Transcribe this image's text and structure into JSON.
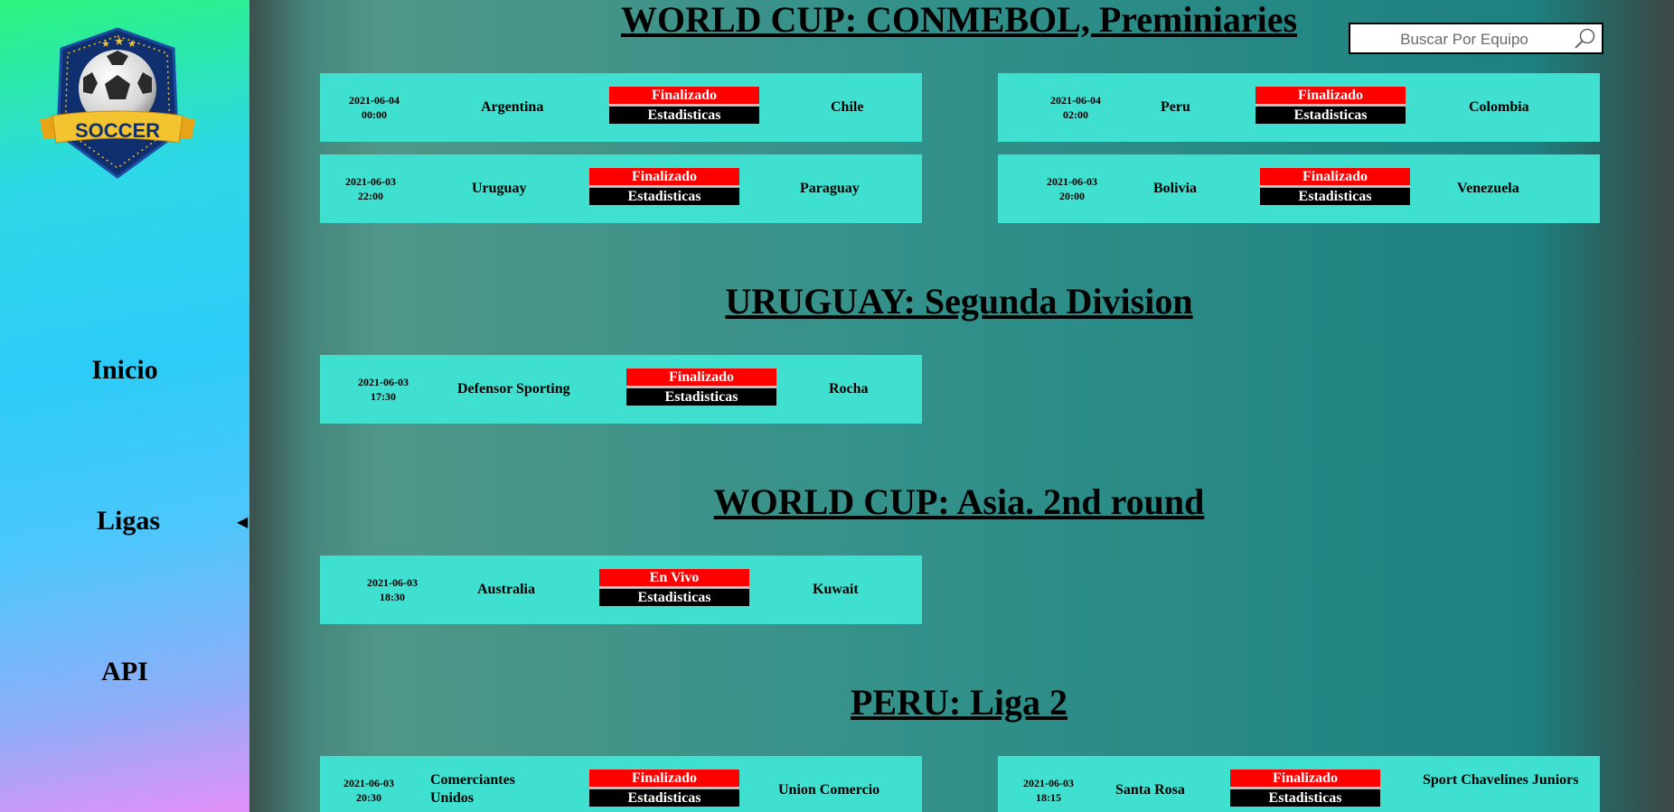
{
  "sidebar": {
    "logo_text": "SOCCER",
    "nav": [
      {
        "label": "Inicio"
      },
      {
        "label": "Ligas"
      },
      {
        "label": "API"
      }
    ],
    "ligas_arrow": "◀"
  },
  "search": {
    "placeholder": "Buscar Por Equipo"
  },
  "colors": {
    "card": "#40e0d0",
    "status": "#ff0000",
    "stats": "#000000"
  },
  "leagues": [
    {
      "title": "WORLD CUP: CONMEBOL, Preminiaries",
      "matches": [
        {
          "date": "2021-06-04",
          "time": "00:00",
          "home": "Argentina",
          "status": "Finalizado",
          "stats": "Estadisticas",
          "away": "Chile"
        },
        {
          "date": "2021-06-04",
          "time": "02:00",
          "home": "Peru",
          "status": "Finalizado",
          "stats": "Estadisticas",
          "away": "Colombia"
        },
        {
          "date": "2021-06-03",
          "time": "22:00",
          "home": "Uruguay",
          "status": "Finalizado",
          "stats": "Estadisticas",
          "away": "Paraguay"
        },
        {
          "date": "2021-06-03",
          "time": "20:00",
          "home": "Bolivia",
          "status": "Finalizado",
          "stats": "Estadisticas",
          "away": "Venezuela"
        }
      ]
    },
    {
      "title": "URUGUAY: Segunda Division",
      "matches": [
        {
          "date": "2021-06-03",
          "time": "17:30",
          "home": "Defensor Sporting",
          "status": "Finalizado",
          "stats": "Estadisticas",
          "away": "Rocha"
        }
      ]
    },
    {
      "title": "WORLD CUP: Asia. 2nd round",
      "matches": [
        {
          "date": "2021-06-03",
          "time": "18:30",
          "home": "Australia",
          "status": "En Vivo",
          "stats": "Estadisticas",
          "away": "Kuwait"
        }
      ]
    },
    {
      "title": "PERU: Liga 2",
      "matches": [
        {
          "date": "2021-06-03",
          "time": "20:30",
          "home": "Comerciantes Unidos",
          "status": "Finalizado",
          "stats": "Estadisticas",
          "away": "Union Comercio"
        },
        {
          "date": "2021-06-03",
          "time": "18:15",
          "home": "Santa Rosa",
          "status": "Finalizado",
          "stats": "Estadisticas",
          "away": "Sport Chavelines Juniors"
        }
      ]
    }
  ]
}
